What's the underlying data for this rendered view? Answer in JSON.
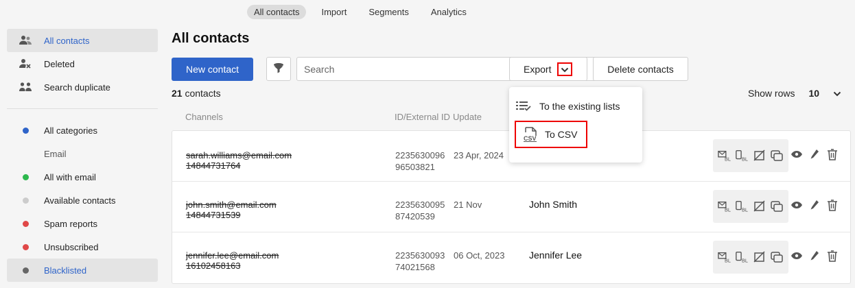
{
  "top_tabs": [
    {
      "label": "All contacts",
      "active": true
    },
    {
      "label": "Import",
      "active": false
    },
    {
      "label": "Segments",
      "active": false
    },
    {
      "label": "Analytics",
      "active": false
    }
  ],
  "sidebar": {
    "top_items": [
      {
        "label": "All contacts",
        "icon": "users-icon",
        "active": true
      },
      {
        "label": "Deleted",
        "icon": "user-x-icon",
        "active": false
      },
      {
        "label": "Search duplicate",
        "icon": "duplicate-users-icon",
        "active": false
      }
    ],
    "all_categories": {
      "label": "All categories",
      "color": "#2f64c9"
    },
    "email_header": "Email",
    "email_items": [
      {
        "label": "All with email",
        "color": "#2db84d",
        "active": false
      },
      {
        "label": "Available contacts",
        "color": "#cccccc",
        "active": false
      },
      {
        "label": "Spam reports",
        "color": "#e04848",
        "active": false
      },
      {
        "label": "Unsubscribed",
        "color": "#e04848",
        "active": false
      },
      {
        "label": "Blacklisted",
        "color": "#666666",
        "active": true
      }
    ]
  },
  "main": {
    "title": "All contacts",
    "new_contact_label": "New contact",
    "search_placeholder": "Search",
    "export_label": "Export",
    "delete_label": "Delete contacts",
    "count_number": "21",
    "count_label": "contacts",
    "show_rows_label": "Show rows",
    "show_rows_value": "10",
    "columns": {
      "channels": "Channels",
      "id": "ID/External ID",
      "update": "Update"
    }
  },
  "export_menu": {
    "items": [
      {
        "label": "To the existing lists",
        "icon": "list-check-icon"
      },
      {
        "label": "To CSV",
        "icon": "csv-file-icon"
      }
    ]
  },
  "rows": [
    {
      "email": "sarah.williams@email.com",
      "phone": "14844731764",
      "id": "2235630096",
      "ext_id": "96503821",
      "date": "23 Apr, 2024",
      "name": ""
    },
    {
      "email": "john.smith@email.com",
      "phone": "14844731539",
      "id": "2235630095",
      "ext_id": "87420539",
      "date": "21 Nov",
      "name": "John Smith"
    },
    {
      "email": "jennifer.lee@email.com",
      "phone": "16102458163",
      "id": "2235630093",
      "ext_id": "74021568",
      "date": "06 Oct, 2023",
      "name": "Jennifer Lee"
    }
  ],
  "channel_icons": [
    "email-blacklist-icon",
    "sms-blacklist-icon",
    "viber-blocked-icon",
    "chat-icon"
  ],
  "colors": {
    "accent": "#2f64c9",
    "highlight": "#ee0000"
  }
}
